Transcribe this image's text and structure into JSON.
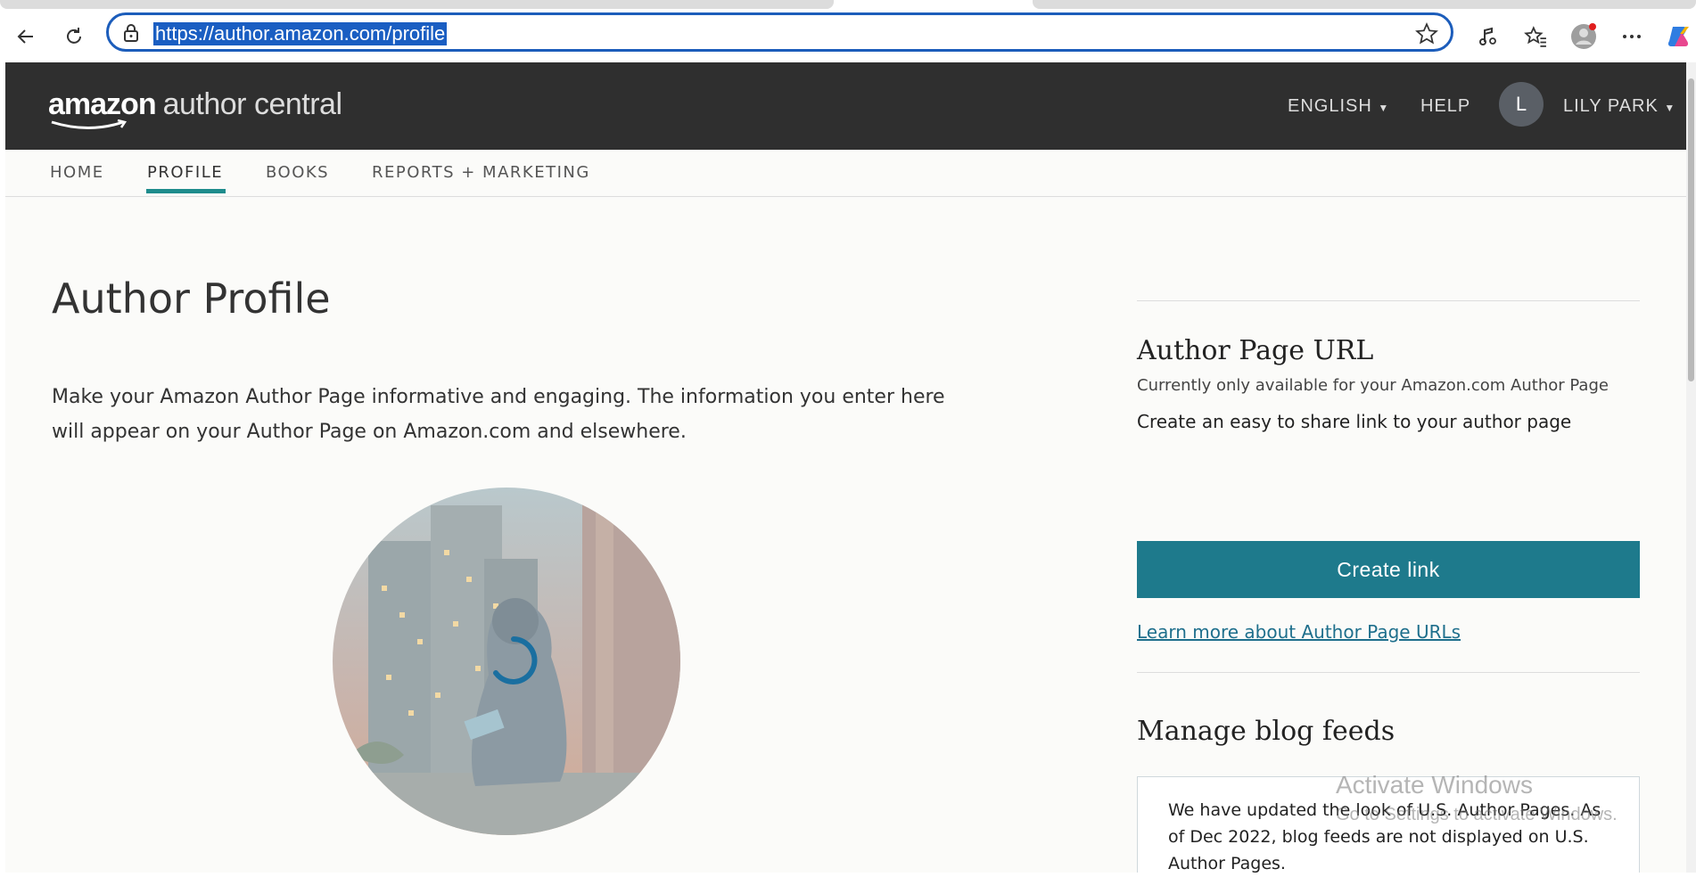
{
  "browser": {
    "url": "https://author.amazon.com/profile"
  },
  "header": {
    "logo_amazon": "amazon",
    "logo_sub": "author central",
    "language": "ENGLISH",
    "help": "HELP",
    "avatar_initial": "L",
    "user_name": "LILY PARK"
  },
  "tabs": [
    {
      "label": "HOME"
    },
    {
      "label": "PROFILE",
      "active": true
    },
    {
      "label": "BOOKS"
    },
    {
      "label": "REPORTS + MARKETING"
    }
  ],
  "main": {
    "title": "Author Profile",
    "intro": "Make your Amazon Author Page informative and engaging. The information you enter here will appear on your Author Page on Amazon.com and elsewhere."
  },
  "sidebar": {
    "url_title": "Author Page URL",
    "url_subtitle": "Currently only available for your Amazon.com Author Page",
    "url_desc": "Create an easy to share link to your author page",
    "create_btn": "Create link",
    "learn_link": "Learn more about Author Page URLs",
    "blog_title": "Manage blog feeds",
    "blog_notice": "We have updated the look of U.S. Author Pages. As of Dec 2022, blog feeds are not displayed on U.S. Author Pages."
  },
  "watermark": {
    "title": "Activate Windows",
    "subtitle": "Go to Settings to activate Windows."
  },
  "colors": {
    "header_bg": "#2f2f2f",
    "accent_teal": "#1e7a8c",
    "tab_underline": "#1e8c8c",
    "url_highlight": "#1a5ec2"
  }
}
